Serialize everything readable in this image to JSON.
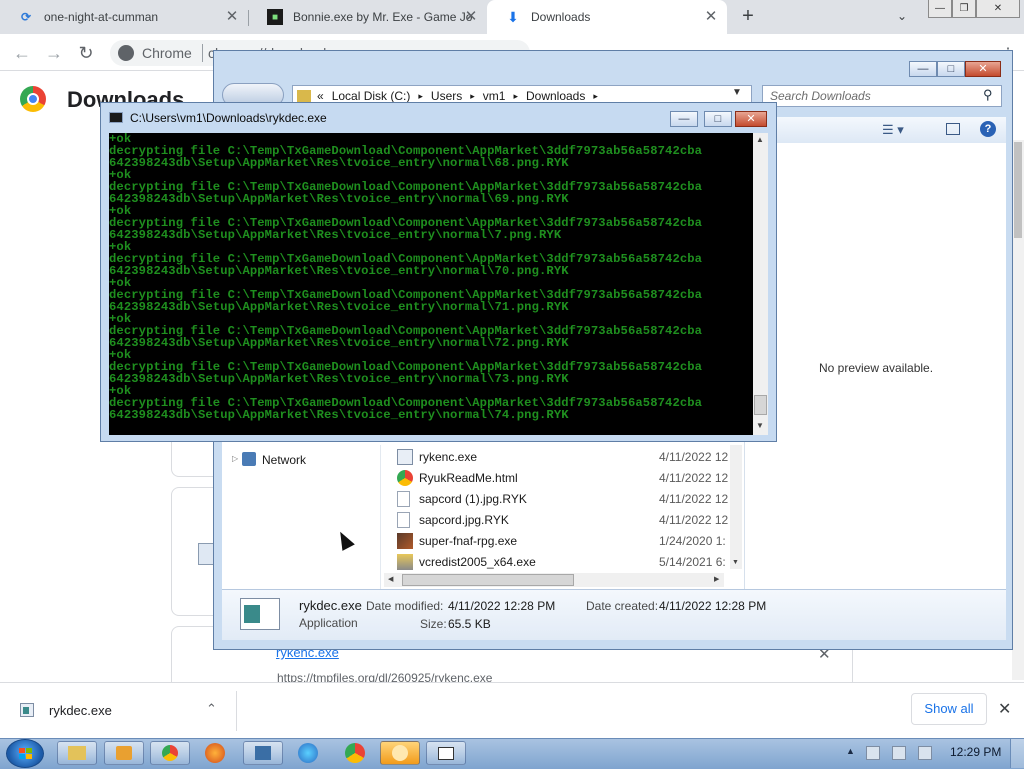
{
  "chrome": {
    "tabs": [
      {
        "label": "one-night-at-cumman"
      },
      {
        "label": "Bonnie.exe by Mr. Exe - Game Jo"
      },
      {
        "label": "Downloads"
      }
    ],
    "new_tab": "+",
    "address_brand": "Chrome",
    "address_url": "chrome://downloads",
    "page_title": "Downloads",
    "entry_name": "rykenc.exe",
    "entry_url": "https://tmpfiles.org/dl/260925/rykenc.exe"
  },
  "explorer": {
    "breadcrumb": [
      "Local Disk (C:)",
      "Users",
      "vm1",
      "Downloads"
    ],
    "search_placeholder": "Search Downloads",
    "no_preview": "No preview available.",
    "nav_network": "Network",
    "files": [
      {
        "name": "rykenc.exe",
        "date": "4/11/2022 12"
      },
      {
        "name": "RyukReadMe.html",
        "date": "4/11/2022 12"
      },
      {
        "name": "sapcord (1).jpg.RYK",
        "date": "4/11/2022 12"
      },
      {
        "name": "sapcord.jpg.RYK",
        "date": "4/11/2022 12"
      },
      {
        "name": "super-fnaf-rpg.exe",
        "date": "1/24/2020 1:"
      },
      {
        "name": "vcredist2005_x64.exe",
        "date": "5/14/2021 6:"
      }
    ],
    "details": {
      "name": "rykdec.exe",
      "type": "Application",
      "modified_label": "Date modified:",
      "modified_value": "4/11/2022 12:28 PM",
      "created_label": "Date created:",
      "created_value": "4/11/2022 12:28 PM",
      "size_label": "Size:",
      "size_value": "65.5 KB"
    }
  },
  "console": {
    "title": "C:\\Users\\vm1\\Downloads\\rykdec.exe",
    "lines": [
      "+ok",
      "decrypting file C:\\Temp\\TxGameDownload\\Component\\AppMarket\\3ddf7973ab56a58742cba",
      "642398243db\\Setup\\AppMarket\\Res\\tvoice_entry\\normal\\68.png.RYK",
      "+ok",
      "decrypting file C:\\Temp\\TxGameDownload\\Component\\AppMarket\\3ddf7973ab56a58742cba",
      "642398243db\\Setup\\AppMarket\\Res\\tvoice_entry\\normal\\69.png.RYK",
      "+ok",
      "decrypting file C:\\Temp\\TxGameDownload\\Component\\AppMarket\\3ddf7973ab56a58742cba",
      "642398243db\\Setup\\AppMarket\\Res\\tvoice_entry\\normal\\7.png.RYK",
      "+ok",
      "decrypting file C:\\Temp\\TxGameDownload\\Component\\AppMarket\\3ddf7973ab56a58742cba",
      "642398243db\\Setup\\AppMarket\\Res\\tvoice_entry\\normal\\70.png.RYK",
      "+ok",
      "decrypting file C:\\Temp\\TxGameDownload\\Component\\AppMarket\\3ddf7973ab56a58742cba",
      "642398243db\\Setup\\AppMarket\\Res\\tvoice_entry\\normal\\71.png.RYK",
      "+ok",
      "decrypting file C:\\Temp\\TxGameDownload\\Component\\AppMarket\\3ddf7973ab56a58742cba",
      "642398243db\\Setup\\AppMarket\\Res\\tvoice_entry\\normal\\72.png.RYK",
      "+ok",
      "decrypting file C:\\Temp\\TxGameDownload\\Component\\AppMarket\\3ddf7973ab56a58742cba",
      "642398243db\\Setup\\AppMarket\\Res\\tvoice_entry\\normal\\73.png.RYK",
      "+ok",
      "decrypting file C:\\Temp\\TxGameDownload\\Component\\AppMarket\\3ddf7973ab56a58742cba",
      "642398243db\\Setup\\AppMarket\\Res\\tvoice_entry\\normal\\74.png.RYK"
    ]
  },
  "shelf": {
    "item": "rykdec.exe",
    "show_all": "Show all"
  },
  "taskbar": {
    "clock": "12:29 PM"
  }
}
